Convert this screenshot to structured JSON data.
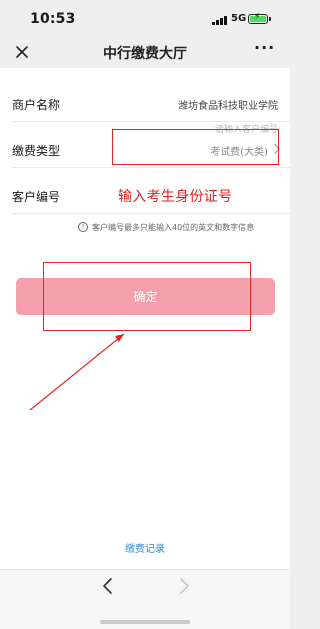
{
  "status_bar": {
    "time": "10:53",
    "network": "5G"
  },
  "nav": {
    "title": "中行缴费大厅"
  },
  "form": {
    "merchant_label": "商户名称",
    "merchant_value": "潍坊食品科技职业学院",
    "fee_type_label": "缴费类型",
    "fee_type_value": "考试费(大类)",
    "customer_no_label": "客户编号",
    "customer_no_placeholder": "请输入客户编号",
    "hint": "客户编号最多只能输入40位的英文和数字信息"
  },
  "confirm_label": "确定",
  "history_label": "缴费记录",
  "annotation": {
    "text": "输入考生身份证号",
    "color": "#e02020"
  },
  "colors": {
    "confirm_bg": "#f4a0ac",
    "link": "#2f8fd6",
    "annotation": "#e32626",
    "battery": "#4cd964"
  },
  "icons": [
    "close-icon",
    "more-icon",
    "chevron-right-icon",
    "info-icon",
    "back-icon",
    "forward-icon"
  ]
}
